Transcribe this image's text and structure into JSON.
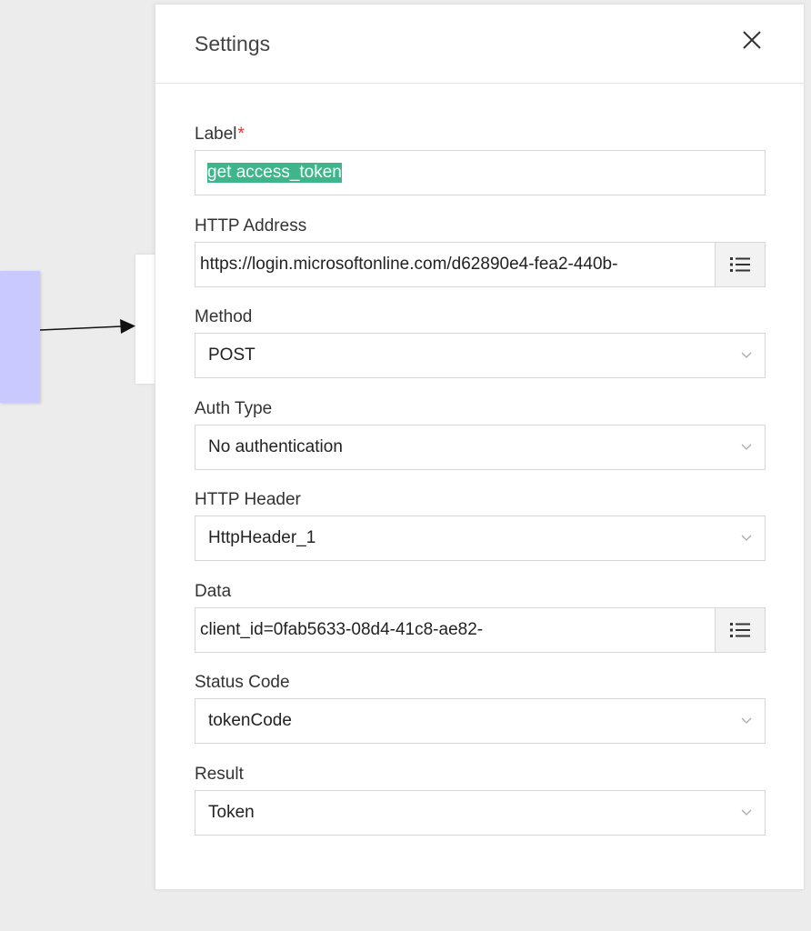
{
  "panel": {
    "title": "Settings",
    "close_icon": "close-icon"
  },
  "fields": {
    "label": {
      "label": "Label",
      "required_mark": "*",
      "value": "get access_token"
    },
    "http_address": {
      "label": "HTTP Address",
      "value": "https://login.microsoftonline.com/d62890e4-fea2-440b-",
      "button_icon": "list-icon"
    },
    "method": {
      "label": "Method",
      "value": "POST"
    },
    "auth_type": {
      "label": "Auth Type",
      "value": "No authentication"
    },
    "http_header": {
      "label": "HTTP Header",
      "value": "HttpHeader_1"
    },
    "data": {
      "label": "Data",
      "value": "client_id=0fab5633-08d4-41c8-ae82-",
      "button_icon": "list-icon"
    },
    "status_code": {
      "label": "Status Code",
      "value": "tokenCode"
    },
    "result": {
      "label": "Result",
      "value": "Token"
    }
  },
  "colors": {
    "selection": "#3fb58c",
    "required": "#e03535",
    "node_fill": "#c9c8ff"
  }
}
